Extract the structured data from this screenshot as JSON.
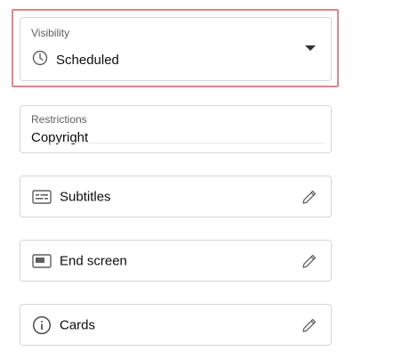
{
  "visibility": {
    "label": "Visibility",
    "value": "Scheduled",
    "icon": "clock-icon"
  },
  "restrictions": {
    "label": "Restrictions",
    "value": "Copyright"
  },
  "actions": [
    {
      "title": "Subtitles",
      "icon": "subtitles-icon",
      "edit_icon": "pencil-icon"
    },
    {
      "title": "End screen",
      "icon": "end-screen-icon",
      "edit_icon": "pencil-icon"
    },
    {
      "title": "Cards",
      "icon": "info-icon",
      "edit_icon": "pencil-icon"
    }
  ],
  "colors": {
    "highlight_border": "#e0868a",
    "field_border": "#d6d6d6",
    "label_text": "#606060",
    "icon": "#606060"
  }
}
